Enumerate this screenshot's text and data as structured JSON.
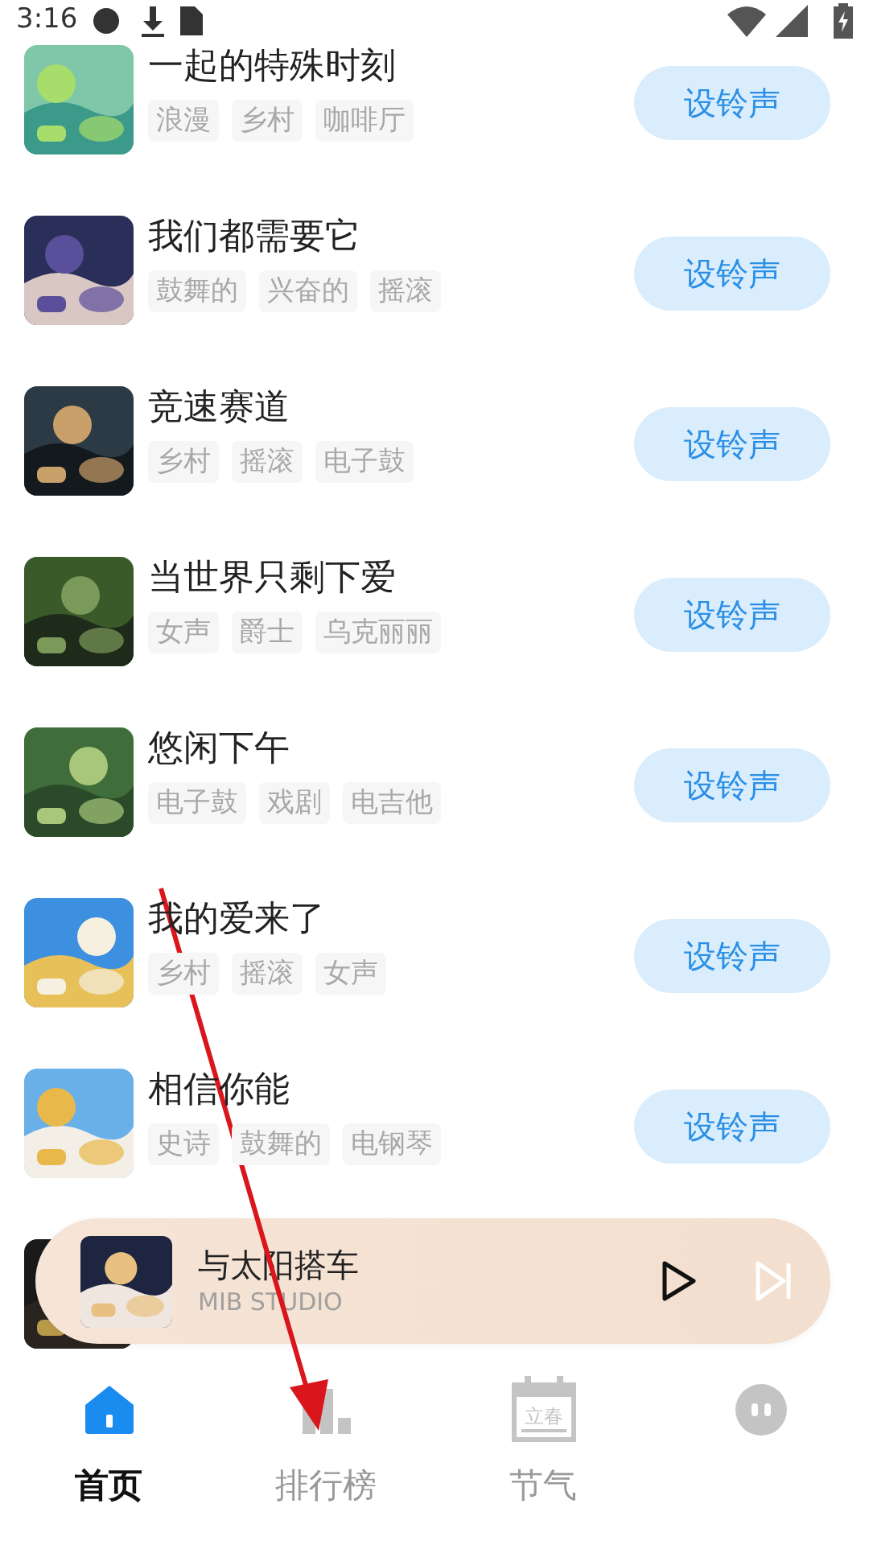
{
  "status_bar": {
    "time": "3:16"
  },
  "songs": [
    {
      "kind": "song",
      "title": "一起的特殊时刻",
      "tags": [
        "浪漫",
        "乡村",
        "咖啡厅"
      ],
      "button": "设铃声"
    },
    {
      "kind": "song",
      "title": "我们都需要它",
      "tags": [
        "鼓舞的",
        "兴奋的",
        "摇滚"
      ],
      "button": "设铃声"
    },
    {
      "kind": "song",
      "title": "竞速赛道",
      "tags": [
        "乡村",
        "摇滚",
        "电子鼓"
      ],
      "button": "设铃声"
    },
    {
      "kind": "song",
      "title": "当世界只剩下爱",
      "tags": [
        "女声",
        "爵士",
        "乌克丽丽"
      ],
      "button": "设铃声"
    },
    {
      "kind": "song",
      "title": "悠闲下午",
      "tags": [
        "电子鼓",
        "戏剧",
        "电吉他"
      ],
      "button": "设铃声"
    },
    {
      "kind": "song",
      "title": "我的爱来了",
      "tags": [
        "乡村",
        "摇滚",
        "女声"
      ],
      "button": "设铃声"
    },
    {
      "kind": "song",
      "title": "相信你能",
      "tags": [
        "史诗",
        "鼓舞的",
        "电钢琴"
      ],
      "button": "设铃声"
    },
    {
      "kind": "picture"
    }
  ],
  "player": {
    "title": "与太阳搭车",
    "artist": "MIB STUDIO"
  },
  "bottom_nav": [
    {
      "kind": "home",
      "label": "首页",
      "selected": true
    },
    {
      "kind": "chart",
      "label": "排行榜",
      "selected": false
    },
    {
      "kind": "calendar",
      "label": "节气",
      "icon_text": "立春",
      "selected": false
    },
    {
      "kind": "face",
      "selected": false
    }
  ]
}
